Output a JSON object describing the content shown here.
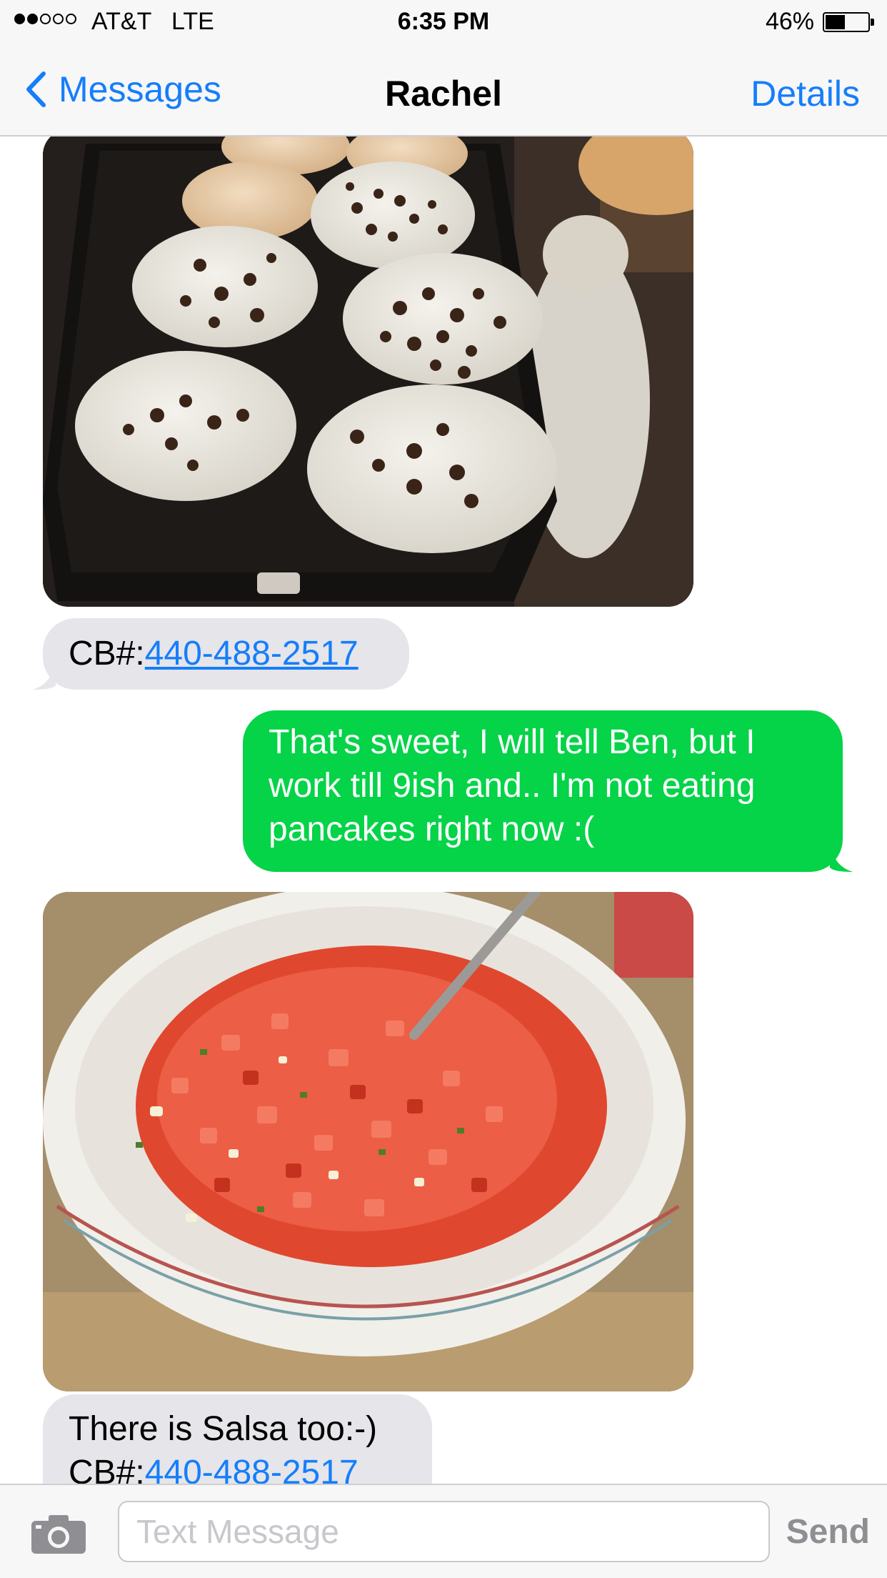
{
  "status_bar": {
    "signal_bars_filled": 2,
    "signal_bars_total": 5,
    "carrier": "AT&T",
    "network": "LTE",
    "time": "6:35 PM",
    "battery_percent_label": "46%",
    "battery_level": 0.46
  },
  "nav": {
    "back_label": "Messages",
    "title": "Rachel",
    "details_label": "Details",
    "accent_color": "#157efb"
  },
  "messages": [
    {
      "direction": "incoming",
      "type": "image",
      "subject": "pancakes"
    },
    {
      "direction": "incoming",
      "type": "text",
      "prefix": "CB#:",
      "phone": "440-488-2517"
    },
    {
      "direction": "outgoing",
      "type": "text",
      "text": "That's sweet, I will tell Ben,  but I work till 9ish and.. I'm not eating pancakes right now :("
    },
    {
      "direction": "incoming",
      "type": "image",
      "subject": "salsa"
    },
    {
      "direction": "incoming",
      "type": "text",
      "text": "There is Salsa too:-)",
      "prefix": "CB#:",
      "phone": "440-488-2517"
    }
  ],
  "colors": {
    "incoming_bubble": "#e5e5ea",
    "outgoing_bubble": "#05d348",
    "link": "#157efb"
  },
  "input_bar": {
    "camera_icon": "camera-icon",
    "placeholder": "Text Message",
    "send_label": "Send"
  }
}
